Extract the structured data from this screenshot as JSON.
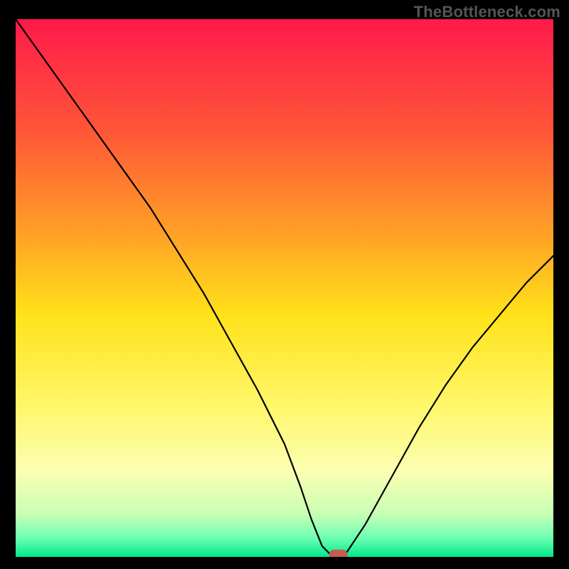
{
  "watermark": {
    "text": "TheBottleneck.com"
  },
  "chart_data": {
    "type": "line",
    "title": "",
    "xlabel": "",
    "ylabel": "",
    "xlim": [
      0,
      100
    ],
    "ylim": [
      0,
      100
    ],
    "grid": false,
    "legend": false,
    "background_gradient": {
      "stops": [
        {
          "offset": 0.0,
          "color": "#ff1a4b"
        },
        {
          "offset": 0.2,
          "color": "#ff5338"
        },
        {
          "offset": 0.4,
          "color": "#ffa126"
        },
        {
          "offset": 0.55,
          "color": "#ffe21a"
        },
        {
          "offset": 0.72,
          "color": "#fff76a"
        },
        {
          "offset": 0.84,
          "color": "#fbffb2"
        },
        {
          "offset": 0.92,
          "color": "#c8ffb4"
        },
        {
          "offset": 0.965,
          "color": "#6dffb3"
        },
        {
          "offset": 1.0,
          "color": "#00e889"
        }
      ]
    },
    "series": [
      {
        "name": "bottleneck-curve",
        "x": [
          0,
          5,
          10,
          15,
          20,
          25,
          30,
          35,
          40,
          45,
          50,
          53,
          55,
          57,
          59,
          61,
          65,
          70,
          75,
          80,
          85,
          90,
          95,
          100
        ],
        "y": [
          100,
          93,
          86,
          79,
          72,
          65,
          57,
          49,
          40,
          31,
          21,
          13,
          7,
          2,
          0,
          0,
          6,
          15,
          24,
          32,
          39,
          45,
          51,
          56
        ]
      }
    ],
    "marker": {
      "name": "optimum-pill",
      "x": 60,
      "y": 0,
      "color": "#c55b52"
    }
  }
}
